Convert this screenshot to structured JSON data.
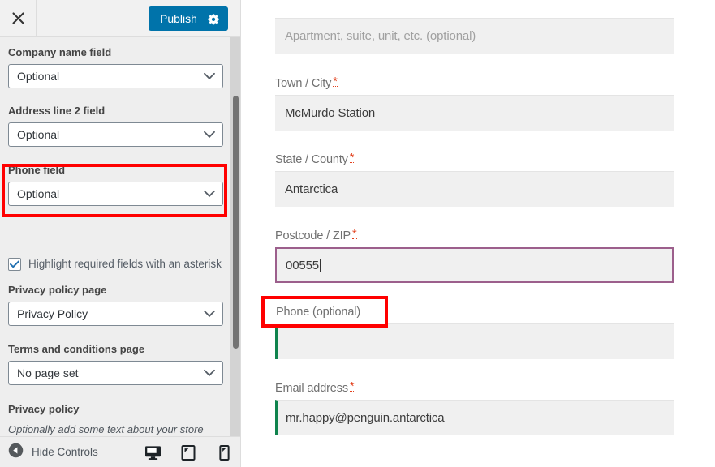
{
  "sidebar": {
    "header": {
      "close_icon": "close-icon",
      "publish_label": "Publish",
      "gear_icon": "gear-icon"
    },
    "controls": [
      {
        "label": "Company name field",
        "value": "Optional",
        "icon": "chevron-down-icon"
      },
      {
        "label": "Address line 2 field",
        "value": "Optional",
        "icon": "chevron-down-icon"
      },
      {
        "label": "Phone field",
        "value": "Optional",
        "icon": "chevron-down-icon",
        "highlighted": true
      },
      {
        "label": "Privacy policy page",
        "value": "Privacy Policy",
        "icon": "chevron-down-icon"
      },
      {
        "label": "Terms and conditions page",
        "value": "No page set",
        "icon": "chevron-down-icon"
      }
    ],
    "checkbox": {
      "label": "Highlight required fields with an asterisk",
      "checked": true
    },
    "privacy_section": {
      "title": "Privacy policy",
      "description": "Optionally add some text about your store privacy policy to show during checkout."
    },
    "footer": {
      "hide_controls_label": "Hide Controls",
      "back_icon": "chevron-left-circle-icon",
      "devices": [
        {
          "name": "desktop",
          "icon": "desktop-icon",
          "active": true
        },
        {
          "name": "tablet",
          "icon": "tablet-icon",
          "active": false
        },
        {
          "name": "mobile",
          "icon": "mobile-icon",
          "active": false
        }
      ]
    }
  },
  "checkout_form": {
    "fields": [
      {
        "name": "address-line-2",
        "label": "",
        "required": false,
        "value": "",
        "placeholder": "Apartment, suite, unit, etc. (optional)",
        "state": "empty"
      },
      {
        "name": "town-city",
        "label": "Town / City",
        "required": true,
        "required_marker": "*",
        "value": "McMurdo Station",
        "state": "filled"
      },
      {
        "name": "state-county",
        "label": "State / County",
        "required": true,
        "required_marker": "*",
        "value": "Antarctica",
        "state": "filled"
      },
      {
        "name": "postcode-zip",
        "label": "Postcode / ZIP",
        "required": true,
        "required_marker": "*",
        "value": "00555",
        "state": "focused"
      },
      {
        "name": "phone",
        "label": "Phone (optional)",
        "required": false,
        "value": "",
        "state": "valid",
        "highlighted": true
      },
      {
        "name": "email-address",
        "label": "Email address",
        "required": true,
        "required_marker": "*",
        "value": "mr.happy@penguin.antarctica",
        "state": "valid"
      }
    ]
  },
  "colors": {
    "publish_blue": "#0073aa",
    "annotation_red": "#ff0000",
    "focus_purple": "#9c5f8c",
    "valid_green": "#0f834d",
    "required_orange": "#e2401c",
    "sidebar_bg": "#eeeeee",
    "input_bg": "#f0f0f0"
  }
}
